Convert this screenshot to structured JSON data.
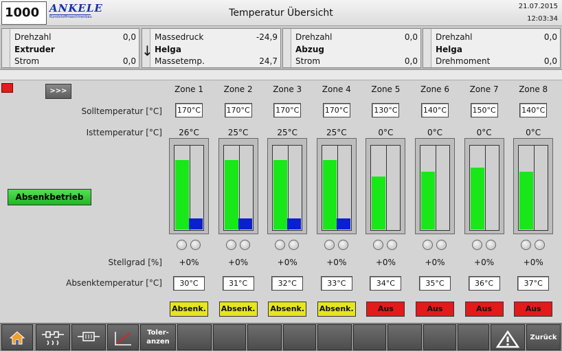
{
  "header": {
    "number": "1000",
    "logo": "ANKELE",
    "logo_sub": "Kunststoffmaschinenbau",
    "title": "Temperatur Übersicht",
    "date": "21.07.2015",
    "time": "12:03:34"
  },
  "panels": [
    {
      "r1_label": "Drehzahl",
      "r1_value": "0,0",
      "name": "Extruder",
      "r3_label": "Strom",
      "r3_value": "0,0"
    },
    {
      "r1_label": "Massedruck",
      "r1_value": "-24,9",
      "name": "Helga",
      "r3_label": "Massetemp.",
      "r3_value": "24,7"
    },
    {
      "r1_label": "Drehzahl",
      "r1_value": "0,0",
      "name": "Abzug",
      "r3_label": "Strom",
      "r3_value": "0,0"
    },
    {
      "r1_label": "Drehzahl",
      "r1_value": "0,0",
      "name": "Helga",
      "r3_label": "Drehmoment",
      "r3_value": "0,0"
    }
  ],
  "more_button": ">>>",
  "labels": {
    "soll": "Solltemperatur [°C]",
    "ist": "Isttemperatur [°C]",
    "stell": "Stellgrad [%]",
    "absenk": "Absenktemperatur [°C]"
  },
  "absenkbetrieb_button": "Absenkbetrieb",
  "zones": [
    {
      "name": "Zone 1",
      "soll": "170°C",
      "ist": "26°C",
      "stell": "+0%",
      "absenk": "30°C",
      "status": "Absenk.",
      "status_color": "#e6e51f",
      "green_fill": 0.82,
      "blue_fill": 0.13
    },
    {
      "name": "Zone 2",
      "soll": "170°C",
      "ist": "25°C",
      "stell": "+0%",
      "absenk": "31°C",
      "status": "Absenk.",
      "status_color": "#e6e51f",
      "green_fill": 0.82,
      "blue_fill": 0.13
    },
    {
      "name": "Zone 3",
      "soll": "170°C",
      "ist": "25°C",
      "stell": "+0%",
      "absenk": "32°C",
      "status": "Absenk.",
      "status_color": "#e6e51f",
      "green_fill": 0.82,
      "blue_fill": 0.13
    },
    {
      "name": "Zone 4",
      "soll": "170°C",
      "ist": "25°C",
      "stell": "+0%",
      "absenk": "33°C",
      "status": "Absenk.",
      "status_color": "#e6e51f",
      "green_fill": 0.82,
      "blue_fill": 0.13
    },
    {
      "name": "Zone 5",
      "soll": "130°C",
      "ist": "0°C",
      "stell": "+0%",
      "absenk": "34°C",
      "status": "Aus",
      "status_color": "#e21a1a",
      "green_fill": 0.63,
      "blue_fill": 0
    },
    {
      "name": "Zone 6",
      "soll": "140°C",
      "ist": "0°C",
      "stell": "+0%",
      "absenk": "35°C",
      "status": "Aus",
      "status_color": "#e21a1a",
      "green_fill": 0.68,
      "blue_fill": 0
    },
    {
      "name": "Zone 7",
      "soll": "150°C",
      "ist": "0°C",
      "stell": "+0%",
      "absenk": "36°C",
      "status": "Aus",
      "status_color": "#e21a1a",
      "green_fill": 0.73,
      "blue_fill": 0
    },
    {
      "name": "Zone 8",
      "soll": "140°C",
      "ist": "0°C",
      "stell": "+0%",
      "absenk": "37°C",
      "status": "Aus",
      "status_color": "#e21a1a",
      "green_fill": 0.68,
      "blue_fill": 0
    }
  ],
  "nav": {
    "tolerances": "Toler-anzen",
    "back": "Zurück",
    "icons": [
      "home-icon",
      "heater-icon",
      "sensor-icon",
      "trend-icon",
      "warning-icon"
    ]
  }
}
